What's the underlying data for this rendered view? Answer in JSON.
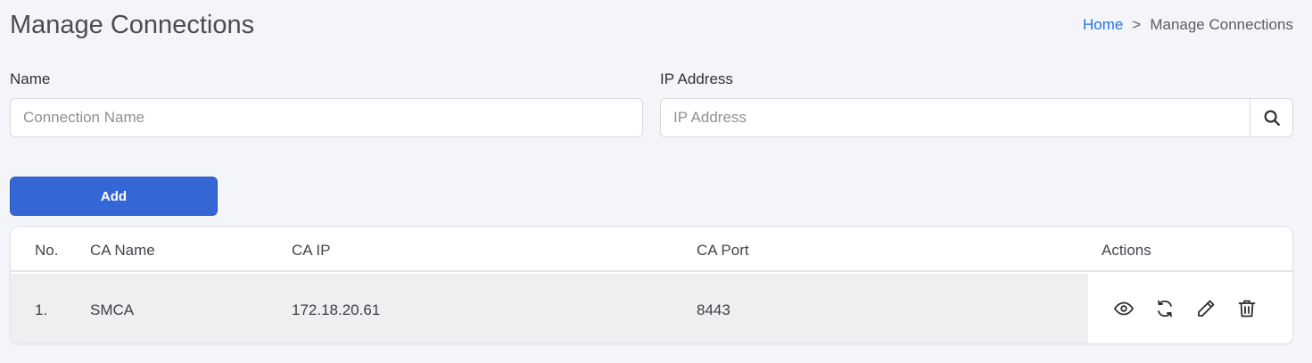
{
  "header": {
    "title": "Manage Connections",
    "breadcrumb": {
      "home": "Home",
      "separator": ">",
      "current": "Manage Connections"
    }
  },
  "filters": {
    "name": {
      "label": "Name",
      "placeholder": "Connection Name",
      "value": ""
    },
    "ip": {
      "label": "IP Address",
      "placeholder": "IP Address",
      "value": ""
    },
    "search_icon": "search-icon"
  },
  "add_button": {
    "label": "Add"
  },
  "table": {
    "columns": [
      "No.",
      "CA Name",
      "CA IP",
      "CA Port",
      "Actions"
    ],
    "rows": [
      {
        "no": "1.",
        "name": "SMCA",
        "ip": "172.18.20.61",
        "port": "8443",
        "actions": [
          "eye-icon",
          "refresh-icon",
          "edit-icon",
          "trash-icon"
        ]
      }
    ]
  },
  "colors": {
    "accent": "#3566d6",
    "link": "#1f73e6",
    "background": "#f4f5f9"
  }
}
